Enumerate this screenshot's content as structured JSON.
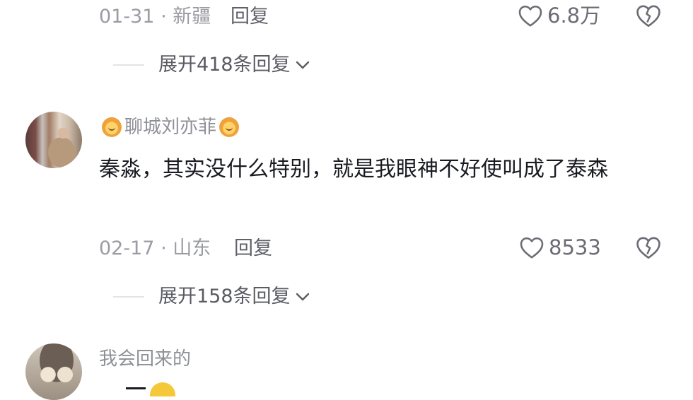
{
  "comments": [
    {
      "date": "01-31",
      "location": "新疆",
      "reply_label": "回复",
      "likes": "6.8万",
      "expand_label": "展开418条回复"
    },
    {
      "username": "聊城刘亦菲",
      "text": "秦淼，其实没什么特别，就是我眼神不好使叫成了泰森",
      "date": "02-17",
      "location": "山东",
      "reply_label": "回复",
      "likes": "8533",
      "expand_label": "展开158条回复"
    },
    {
      "username": "我会回来的"
    }
  ],
  "separator": "·",
  "icons": {
    "like": "heart-outline-icon",
    "dislike": "broken-heart-icon",
    "expand": "chevron-down-icon",
    "badge": "lion-emoji-icon"
  },
  "colors": {
    "meta_text": "#9a9ba3",
    "body_text": "#1a1b22",
    "divider": "#e4e4e8"
  }
}
